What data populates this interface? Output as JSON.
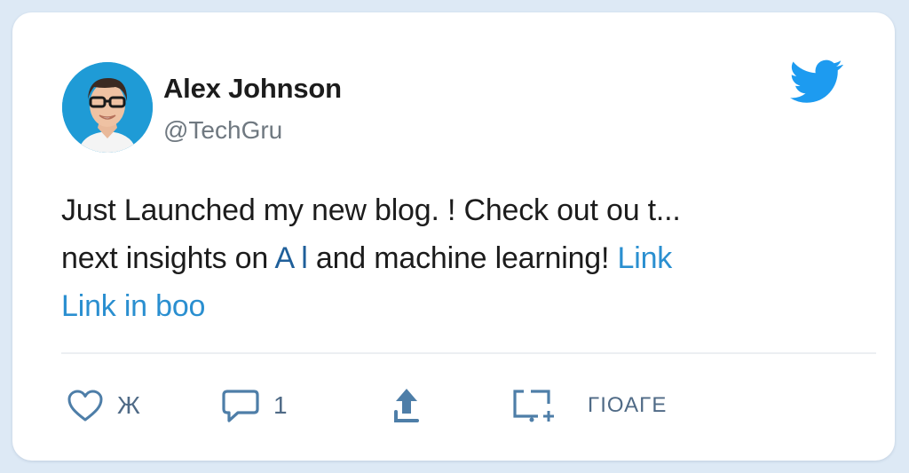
{
  "tweet": {
    "author": {
      "name": "Alex Johnson",
      "handle": "@TechGru"
    },
    "text": {
      "line1": "Just Launched my new blog. !  Check out ou t...",
      "line2_a": "next insights on ",
      "line2_ai": "A l",
      "line2_b": " and machine learning!",
      "line2_link": "Link",
      "line3_link": "Link in boo"
    },
    "actions": {
      "like_count": "Ж",
      "reply_count": "1",
      "save_label": "ΓΙΟΑΓΕ"
    }
  },
  "colors": {
    "background": "#dde9f5",
    "card": "#ffffff",
    "twitter_blue": "#1d9bf0",
    "link": "#2a8fd0",
    "icon": "#4e7ea8"
  },
  "icons": [
    "twitter-bird-icon",
    "heart-icon",
    "reply-bubble-icon",
    "share-arrow-icon",
    "save-frame-icon"
  ]
}
